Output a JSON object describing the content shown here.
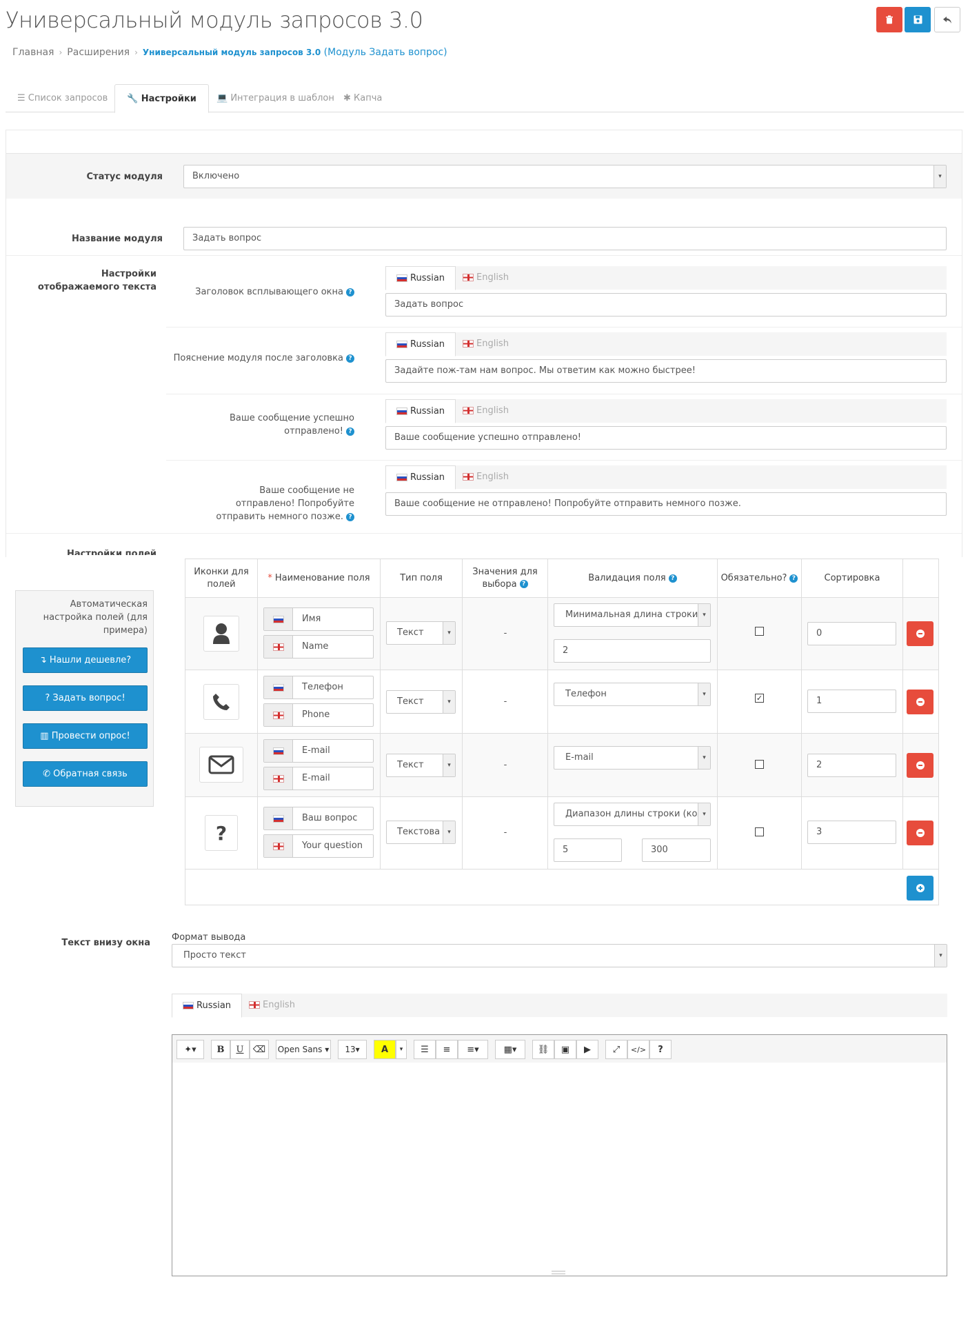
{
  "header": {
    "title": "Универсальный модуль запросов 3.0",
    "colors": {
      "danger": "#e74c3c",
      "primary": "#1e91cf"
    }
  },
  "breadcrumb": {
    "home": "Главная",
    "ext": "Расширения",
    "current": "Универсальный модуль запросов 3.0",
    "current_suffix": "(Модуль Задать вопрос)"
  },
  "tabs": {
    "list": "Список запросов",
    "settings": "Настройки",
    "integration": "Интеграция в шаблон",
    "captcha": "Капча"
  },
  "settings": {
    "status_label": "Статус модуля",
    "status_value": "Включено",
    "name_label": "Название модуля",
    "name_value": "Задать вопрос",
    "text_section_label": "Настройки отображаемого текста",
    "fields_section_label": "Настройки полей",
    "lang_ru": "Russian",
    "lang_en": "English",
    "texts": [
      {
        "label": "Заголовок всплывающего окна",
        "value": "Задать вопрос"
      },
      {
        "label": "Пояснение модуля после заголовка",
        "value": "Задайте пож-там нам вопрос. Мы ответим как можно быстрее!"
      },
      {
        "label": "Ваше сообщение успешно отправлено!",
        "value": "Ваше сообщение успешно отправлено!"
      },
      {
        "label": "Ваше сообщение не отправлено! Попробуйте отправить немного позже.",
        "value": "Ваше сообщение не отправлено! Попробуйте отправить немного позже."
      }
    ]
  },
  "auto": {
    "title": "Автоматическая настройка полей (для примера)",
    "buttons": [
      "Нашли дешевле?",
      "Задать вопрос!",
      "Провести опрос!",
      "Обратная связь"
    ]
  },
  "fields_table": {
    "headers": {
      "icons": "Иконки для полей",
      "name": "Наименование поля",
      "type": "Тип поля",
      "values": "Значения для выбора",
      "validation": "Валидация поля",
      "required": "Обязательно?",
      "sort": "Сортировка"
    },
    "rows": [
      {
        "icon": "user-icon",
        "ru": "Имя",
        "en": "Name",
        "type": "Текст",
        "values": "-",
        "validation": "Минимальная длина строки",
        "val1": "2",
        "required": false,
        "sort": "0"
      },
      {
        "icon": "phone-icon",
        "ru": "Телефон",
        "en": "Phone",
        "type": "Текст",
        "values": "-",
        "validation": "Телефон",
        "required": true,
        "sort": "1"
      },
      {
        "icon": "envelope-icon",
        "ru": "E-mail",
        "en": "E-mail",
        "type": "Текст",
        "values": "-",
        "validation": "E-mail",
        "required": false,
        "sort": "2"
      },
      {
        "icon": "question-icon",
        "ru": "Ваш вопрос",
        "en": "Your question",
        "type": "Текстова",
        "values": "-",
        "validation": "Диапазон длины строки (кол",
        "val1": "5",
        "val2": "300",
        "required": false,
        "sort": "3"
      }
    ]
  },
  "bottom": {
    "label": "Текст внизу окна",
    "format_label": "Формат вывода",
    "format_value": "Просто текст",
    "font_name": "Open Sans",
    "font_size": "13"
  }
}
